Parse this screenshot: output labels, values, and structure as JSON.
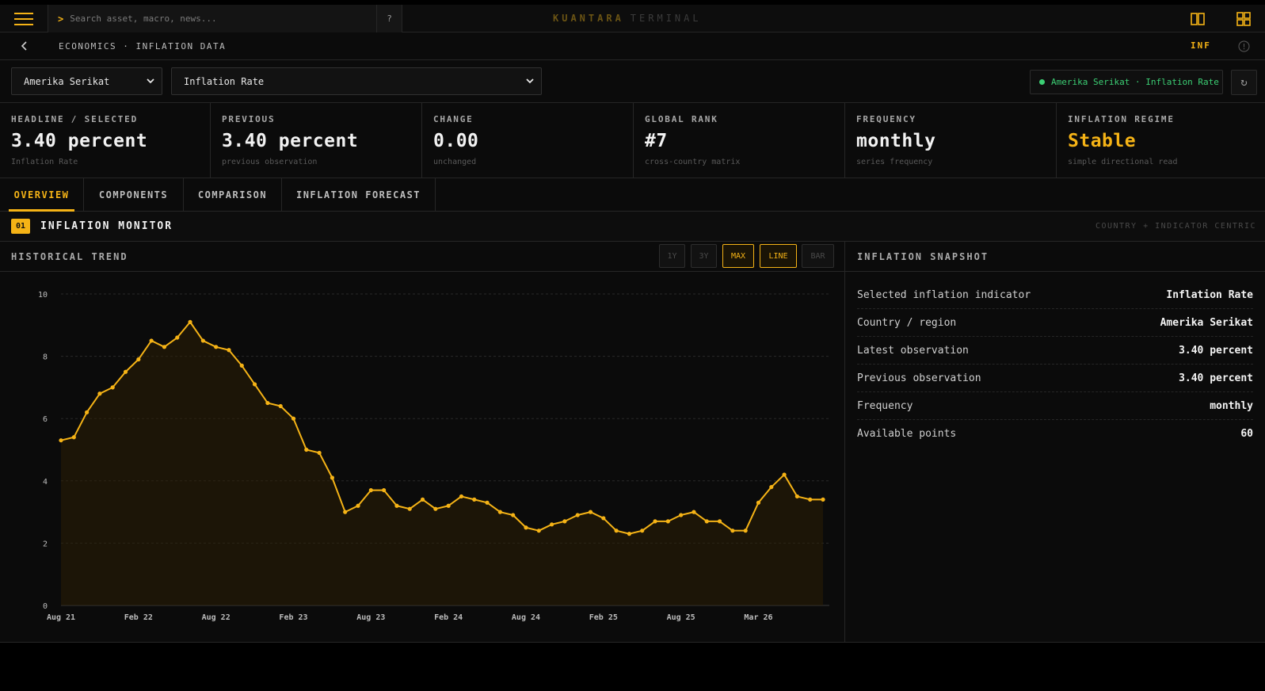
{
  "search": {
    "prompt": ">",
    "placeholder": "Search asset, macro, news...",
    "help": "?"
  },
  "brand": {
    "primary": "KUANTARA",
    "secondary": "TERMINAL"
  },
  "breadcrumb": {
    "text": "ECONOMICS · INFLATION DATA",
    "code": "INF"
  },
  "selectors": {
    "country": "Amerika Serikat",
    "indicator": "Inflation Rate"
  },
  "status": {
    "text": "Amerika Serikat · Inflation Rate",
    "color": "#3ccf74"
  },
  "refresh_glyph": "↻",
  "kpis": [
    {
      "label": "HEADLINE / SELECTED",
      "value": "3.40 percent",
      "sub": "Inflation Rate"
    },
    {
      "label": "PREVIOUS",
      "value": "3.40 percent",
      "sub": "previous observation"
    },
    {
      "label": "CHANGE",
      "value": "0.00",
      "sub": "unchanged"
    },
    {
      "label": "GLOBAL RANK",
      "value": "#7",
      "sub": "cross-country matrix"
    },
    {
      "label": "FREQUENCY",
      "value": "monthly",
      "sub": "series frequency"
    },
    {
      "label": "INFLATION REGIME",
      "value": "Stable",
      "sub": "simple directional read"
    }
  ],
  "tabs": [
    {
      "label": "OVERVIEW",
      "active": true
    },
    {
      "label": "COMPONENTS",
      "active": false
    },
    {
      "label": "COMPARISON",
      "active": false
    },
    {
      "label": "INFLATION FORECAST",
      "active": false
    }
  ],
  "section": {
    "number": "01",
    "title": "INFLATION MONITOR",
    "right_note": "COUNTRY + INDICATOR CENTRIC"
  },
  "chart_panel": {
    "title": "HISTORICAL TREND",
    "buttons": [
      {
        "label": "1Y",
        "active": false
      },
      {
        "label": "3Y",
        "active": false
      },
      {
        "label": "MAX",
        "active": true
      },
      {
        "label": "LINE",
        "active": true
      },
      {
        "label": "BAR",
        "active": false
      }
    ]
  },
  "snapshot": {
    "title": "INFLATION SNAPSHOT",
    "rows": [
      {
        "key": "Selected inflation indicator",
        "value": "Inflation Rate"
      },
      {
        "key": "Country / region",
        "value": "Amerika Serikat"
      },
      {
        "key": "Latest observation",
        "value": "3.40 percent"
      },
      {
        "key": "Previous observation",
        "value": "3.40 percent"
      },
      {
        "key": "Frequency",
        "value": "monthly"
      },
      {
        "key": "Available points",
        "value": "60"
      }
    ]
  },
  "colors": {
    "accent": "#f5b316",
    "positive": "#3ccf74",
    "background": "#0b0b0b",
    "grid": "#2a2a2a"
  },
  "icons": [
    "hamburger-menu-icon",
    "split-view-icon",
    "grid-layout-icon",
    "back-arrow-icon",
    "info-icon",
    "chevron-down-icon",
    "refresh-icon"
  ],
  "chart_data": {
    "type": "area",
    "title": "",
    "xlabel": "",
    "ylabel": "",
    "ylim": [
      0,
      10
    ],
    "yticks": [
      0,
      2,
      4,
      6,
      8,
      10
    ],
    "xtick_labels": [
      "Aug 21",
      "Feb 22",
      "Aug 22",
      "Feb 23",
      "Aug 23",
      "Feb 24",
      "Aug 24",
      "Feb 25",
      "Aug 25",
      "Mar 26"
    ],
    "grid": true,
    "series": [
      {
        "values": [
          5.3,
          5.4,
          6.2,
          6.8,
          7.0,
          7.5,
          7.9,
          8.5,
          8.3,
          8.6,
          9.1,
          8.5,
          8.3,
          8.2,
          7.7,
          7.1,
          6.5,
          6.4,
          6.0,
          5.0,
          4.9,
          4.1,
          3.0,
          3.2,
          3.7,
          3.7,
          3.2,
          3.1,
          3.4,
          3.1,
          3.2,
          3.5,
          3.4,
          3.3,
          3.0,
          2.9,
          2.5,
          2.4,
          2.6,
          2.7,
          2.9,
          3.0,
          2.8,
          2.4,
          2.3,
          2.4,
          2.7,
          2.7,
          2.9,
          3.0,
          2.7,
          2.7,
          2.4,
          2.4,
          3.3,
          3.8,
          4.2,
          3.5,
          3.4,
          3.4
        ],
        "color": "#f5b316"
      }
    ]
  }
}
